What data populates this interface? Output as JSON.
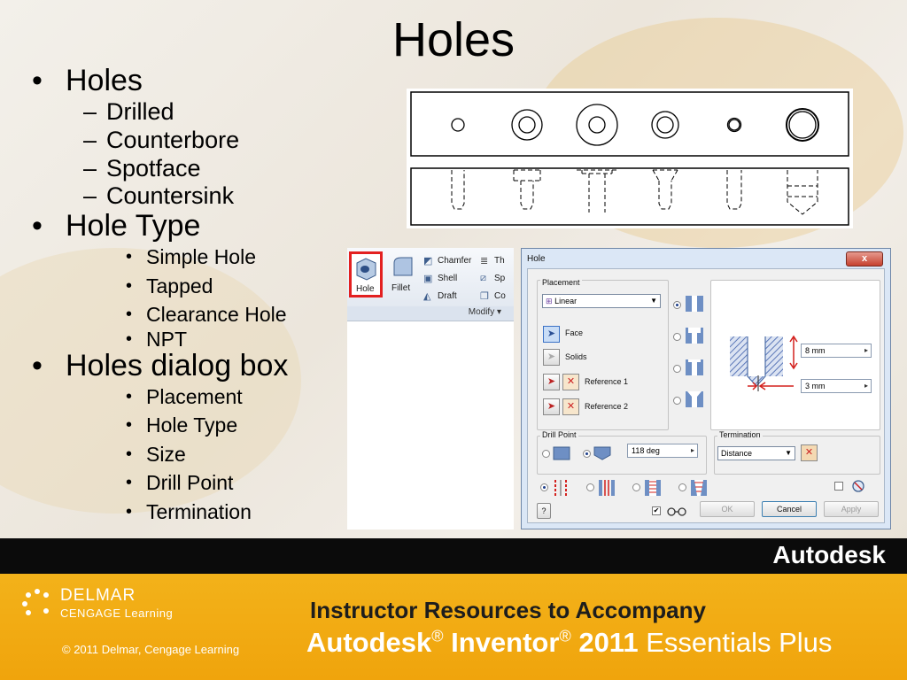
{
  "slide": {
    "title": "Holes",
    "bullets": [
      {
        "level": 1,
        "text": "Holes"
      },
      {
        "level": 2,
        "text": "Drilled"
      },
      {
        "level": 2,
        "text": "Counterbore"
      },
      {
        "level": 2,
        "text": "Spotface"
      },
      {
        "level": 2,
        "text": "Countersink"
      },
      {
        "level": 1,
        "text": "Hole Type"
      },
      {
        "level": 3,
        "text": "Simple Hole"
      },
      {
        "level": 3,
        "text": "Tapped"
      },
      {
        "level": 3,
        "text": "Clearance Hole"
      },
      {
        "level": 3,
        "text": "NPT"
      },
      {
        "level": 1,
        "text": "Holes dialog box"
      },
      {
        "level": 3,
        "text": "Placement"
      },
      {
        "level": 3,
        "text": "Hole Type"
      },
      {
        "level": 3,
        "text": "Size"
      },
      {
        "level": 3,
        "text": "Drill Point"
      },
      {
        "level": 3,
        "text": "Termination"
      }
    ]
  },
  "ribbon": {
    "hole_label": "Hole",
    "fillet_label": "Fillet",
    "chamfer_label": "Chamfer",
    "shell_label": "Shell",
    "draft_label": "Draft",
    "thread_label": "Th",
    "split_label": "Sp",
    "combine_label": "Co",
    "panel_label": "Modify ▾"
  },
  "dialog": {
    "title": "Hole",
    "close_label": "x",
    "placement": {
      "group_label": "Placement",
      "combo_value": "Linear",
      "face_label": "Face",
      "solids_label": "Solids",
      "reference1_label": "Reference 1",
      "reference2_label": "Reference 2"
    },
    "size": {
      "depth_value": "8 mm",
      "diameter_value": "3 mm"
    },
    "drill_point": {
      "group_label": "Drill Point",
      "angle_value": "118 deg"
    },
    "termination": {
      "group_label": "Termination",
      "value": "Distance"
    },
    "buttons": {
      "help": "?",
      "ok": "OK",
      "cancel": "Cancel",
      "apply": "Apply"
    },
    "colors": {
      "hatch": "#5b77b8",
      "dim_red": "#d3201d",
      "hole_blue": "#4d6fa8"
    }
  },
  "footer": {
    "brand": "Autodesk",
    "publisher": "DELMAR",
    "publisher_sub": "CENGAGE Learning",
    "copyright": "© 2011 Delmar, Cengage Learning",
    "headline": "Instructor Resources to Accompany",
    "product_a": "Autodesk",
    "product_b": "Inventor",
    "product_c": "2011",
    "product_d": "Essentials Plus",
    "colors": {
      "bar_black": "#0b0b0b",
      "bar_orange": "#f3b21a"
    }
  }
}
